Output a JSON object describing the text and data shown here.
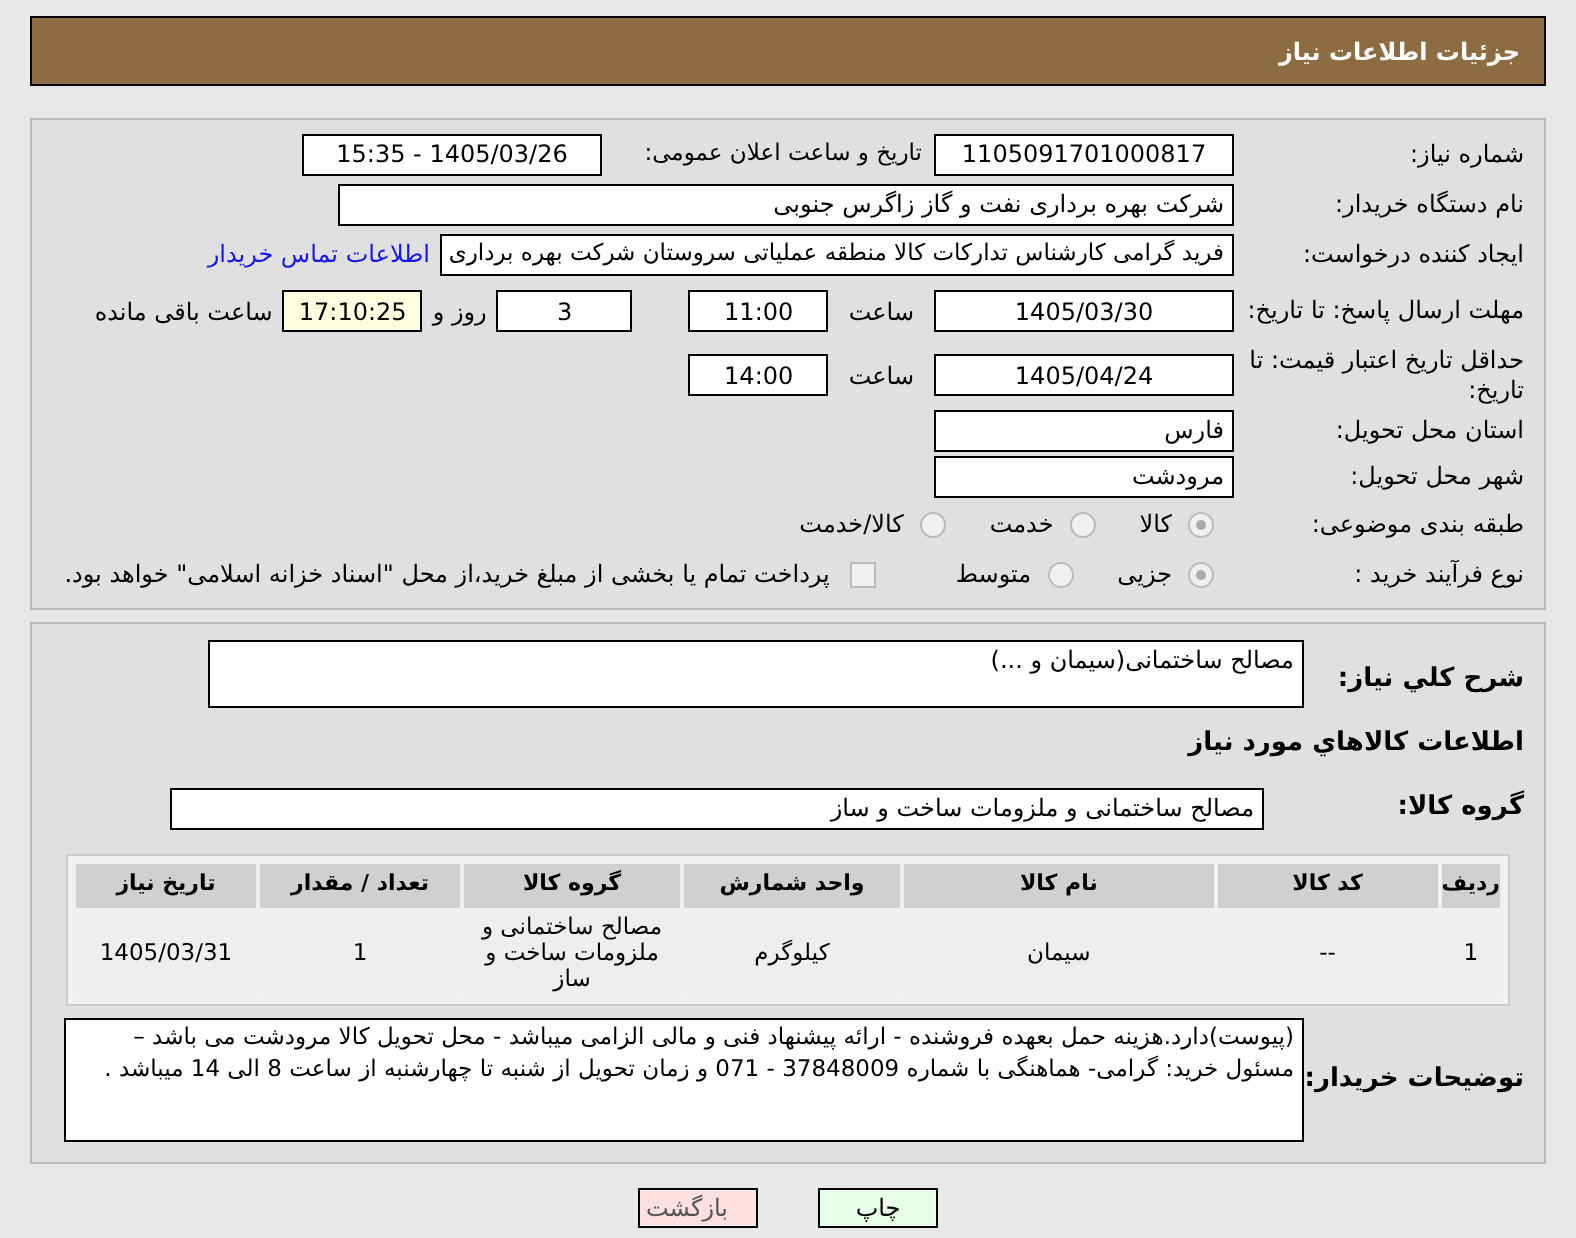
{
  "header": {
    "title": "جزئیات اطلاعات نیاز"
  },
  "need_number": {
    "label": "شماره نیاز:",
    "value": "1105091701000817"
  },
  "announce": {
    "label": "تاریخ و ساعت اعلان عمومی:",
    "value": "1405/03/26 - 15:35"
  },
  "buyer": {
    "label": "نام دستگاه خریدار:",
    "value": "شرکت بهره برداری نفت و گاز زاگرس جنوبی"
  },
  "creator": {
    "label": "ایجاد کننده درخواست:",
    "value": "فرید گرامی کارشناس تدارکات کالا منطقه عملیاتی سروستان شرکت بهره برداری",
    "link": "اطلاعات تماس خریدار"
  },
  "deadline": {
    "label": "مهلت ارسال پاسخ: تا تاریخ:",
    "date": "1405/03/30",
    "time_label": "ساعت",
    "time": "11:00",
    "days": "3",
    "days_label": "روز و",
    "remaining": "17:10:25",
    "remaining_label": "ساعت باقی مانده"
  },
  "validity": {
    "label": "حداقل تاریخ اعتبار قیمت: تا تاریخ:",
    "date": "1405/04/24",
    "time_label": "ساعت",
    "time": "14:00"
  },
  "province": {
    "label": "استان محل تحویل:",
    "value": "فارس"
  },
  "city": {
    "label": "شهر محل تحویل:",
    "value": "مرودشت"
  },
  "category": {
    "label": "طبقه بندی موضوعی:",
    "options": [
      {
        "label": "کالا",
        "selected": true
      },
      {
        "label": "خدمت",
        "selected": false
      },
      {
        "label": "کالا/خدمت",
        "selected": false
      }
    ]
  },
  "process": {
    "label": "نوع فرآیند خرید :",
    "options": [
      {
        "label": "جزیی",
        "selected": true
      },
      {
        "label": "متوسط",
        "selected": false
      }
    ],
    "checkbox": {
      "label": "پرداخت تمام یا بخشی از مبلغ خرید،از محل \"اسناد خزانه اسلامی\" خواهد بود.",
      "checked": false
    }
  },
  "summary": {
    "label": "شرح کلي نياز:",
    "value": "مصالح ساختمانی(سیمان و ...)"
  },
  "items_title": "اطلاعات کالاهاي مورد نياز",
  "goods_group": {
    "label": "گروه کالا:",
    "value": "مصالح ساختمانی و ملزومات ساخت و ساز"
  },
  "table": {
    "columns": [
      "ردیف",
      "کد کالا",
      "نام کالا",
      "واحد شمارش",
      "گروه کالا",
      "تعداد / مقدار",
      "تاریخ نیاز"
    ],
    "rows": [
      [
        "1",
        "--",
        "سیمان",
        "کیلوگرم",
        "مصالح ساختمانی و ملزومات ساخت و ساز",
        "1",
        "1405/03/31"
      ]
    ]
  },
  "notes": {
    "label": "توضیحات خریدار:",
    "lines": [
      "(پیوست)دارد.هزینه حمل بعهده فروشنده - ارائه پیشنهاد فنی و مالی الزامی میباشد - محل تحویل کالا مرودشت می باشد –",
      "مسئول خرید: گرامی- هماهنگی با شماره 37848009 - 071 و زمان تحویل از شنبه تا چهارشنبه از ساعت 8 الی 14 میباشد ."
    ]
  },
  "buttons": [
    {
      "label": "چاپ",
      "kind": "print"
    },
    {
      "label": "بازگشت",
      "kind": "back"
    }
  ]
}
